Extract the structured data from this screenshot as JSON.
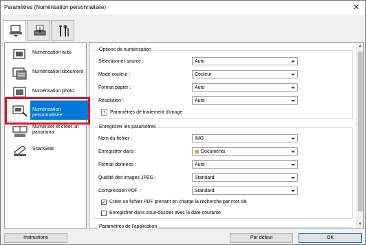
{
  "window": {
    "title": "Paramètres (Numérisation personnalisée)"
  },
  "tabs": [
    {
      "icon": "scan-from-computer-icon",
      "active": true
    },
    {
      "icon": "scan-from-panel-icon",
      "active": false
    },
    {
      "icon": "general-settings-icon",
      "active": false
    }
  ],
  "sidebar": {
    "items": [
      {
        "label": "Numérisation auto",
        "icon": "auto-scan-icon"
      },
      {
        "label": "Numérisation document",
        "icon": "document-scan-icon"
      },
      {
        "label": "Numérisation photo",
        "icon": "photo-scan-icon"
      },
      {
        "label": "Numérisation personnalisée",
        "icon": "custom-scan-icon",
        "selected": true
      },
      {
        "label": "Numériser et créer un panorama",
        "icon": "panorama-icon"
      },
      {
        "label": "ScanGear",
        "icon": "scangear-icon"
      }
    ]
  },
  "scan_options": {
    "title": "Options de numérisation",
    "source_label": "Sélectionner source :",
    "source_value": "Auto",
    "color_label": "Mode couleur :",
    "color_value": "Couleur",
    "paper_label": "Format papier :",
    "paper_value": "Auto",
    "resolution_label": "Résolution :",
    "resolution_value": "Auto",
    "processing_label": "Paramètres de traitement d'image"
  },
  "save_settings": {
    "title": "Enregistrer les paramètres",
    "filename_label": "Nom du fichier :",
    "filename_value": "IMG",
    "savein_label": "Enregistrer dans :",
    "savein_value": "Documents",
    "format_label": "Format données :",
    "format_value": "Auto",
    "jpeg_label": "Qualité des images JPEG :",
    "jpeg_value": "Standard",
    "pdf_label": "Compression PDF :",
    "pdf_value": "Standard",
    "keyword_pdf_label": "Créer un fichier PDF prenant en charge la recherche par mot clé",
    "keyword_pdf_checked": true,
    "subfolder_label": "Enregistrer dans sous-dossier avec la date courante",
    "subfolder_checked": false
  },
  "app_settings": {
    "title": "Paramètres de l'application"
  },
  "buttons": {
    "instructions": "Instructions",
    "default": "Par défaut",
    "ok": "OK"
  }
}
